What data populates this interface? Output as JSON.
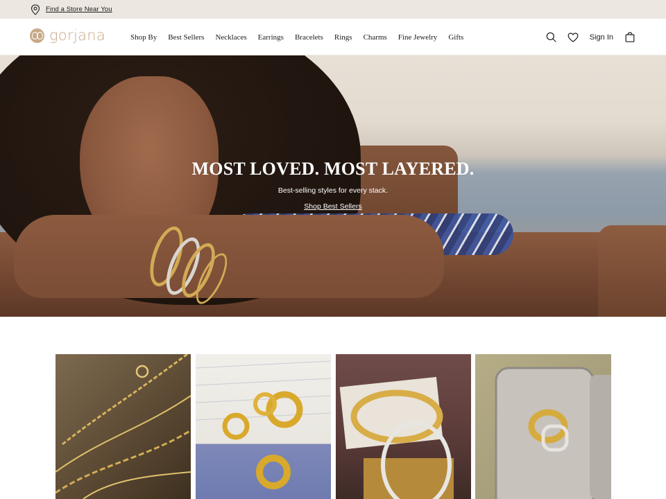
{
  "utility_bar": {
    "store_link": "Find a Store Near You",
    "icon": "location-pin-icon"
  },
  "header": {
    "logo_text": "gorjana",
    "nav": [
      {
        "label": "Shop By"
      },
      {
        "label": "Best Sellers"
      },
      {
        "label": "Necklaces"
      },
      {
        "label": "Earrings"
      },
      {
        "label": "Bracelets"
      },
      {
        "label": "Rings"
      },
      {
        "label": "Charms"
      },
      {
        "label": "Fine Jewelry"
      },
      {
        "label": "Gifts"
      }
    ],
    "actions": {
      "search_icon": "search-icon",
      "wishlist_icon": "heart-icon",
      "sign_in": "Sign In",
      "bag_icon": "shopping-bag-icon"
    }
  },
  "hero": {
    "title": "MOST LOVED. MOST LAYERED.",
    "subtitle": "Best-selling styles for every stack.",
    "cta": "Shop Best Sellers"
  },
  "product_tiles": [
    {
      "alt": "gold chain necklaces"
    },
    {
      "alt": "gold hoop earrings on card"
    },
    {
      "alt": "gold and silver bangles"
    },
    {
      "alt": "gold and silver rings in tin"
    }
  ],
  "colors": {
    "utility_bg": "#ece8e1",
    "brand_gold": "#c8a987",
    "text": "#1a1a1a"
  }
}
